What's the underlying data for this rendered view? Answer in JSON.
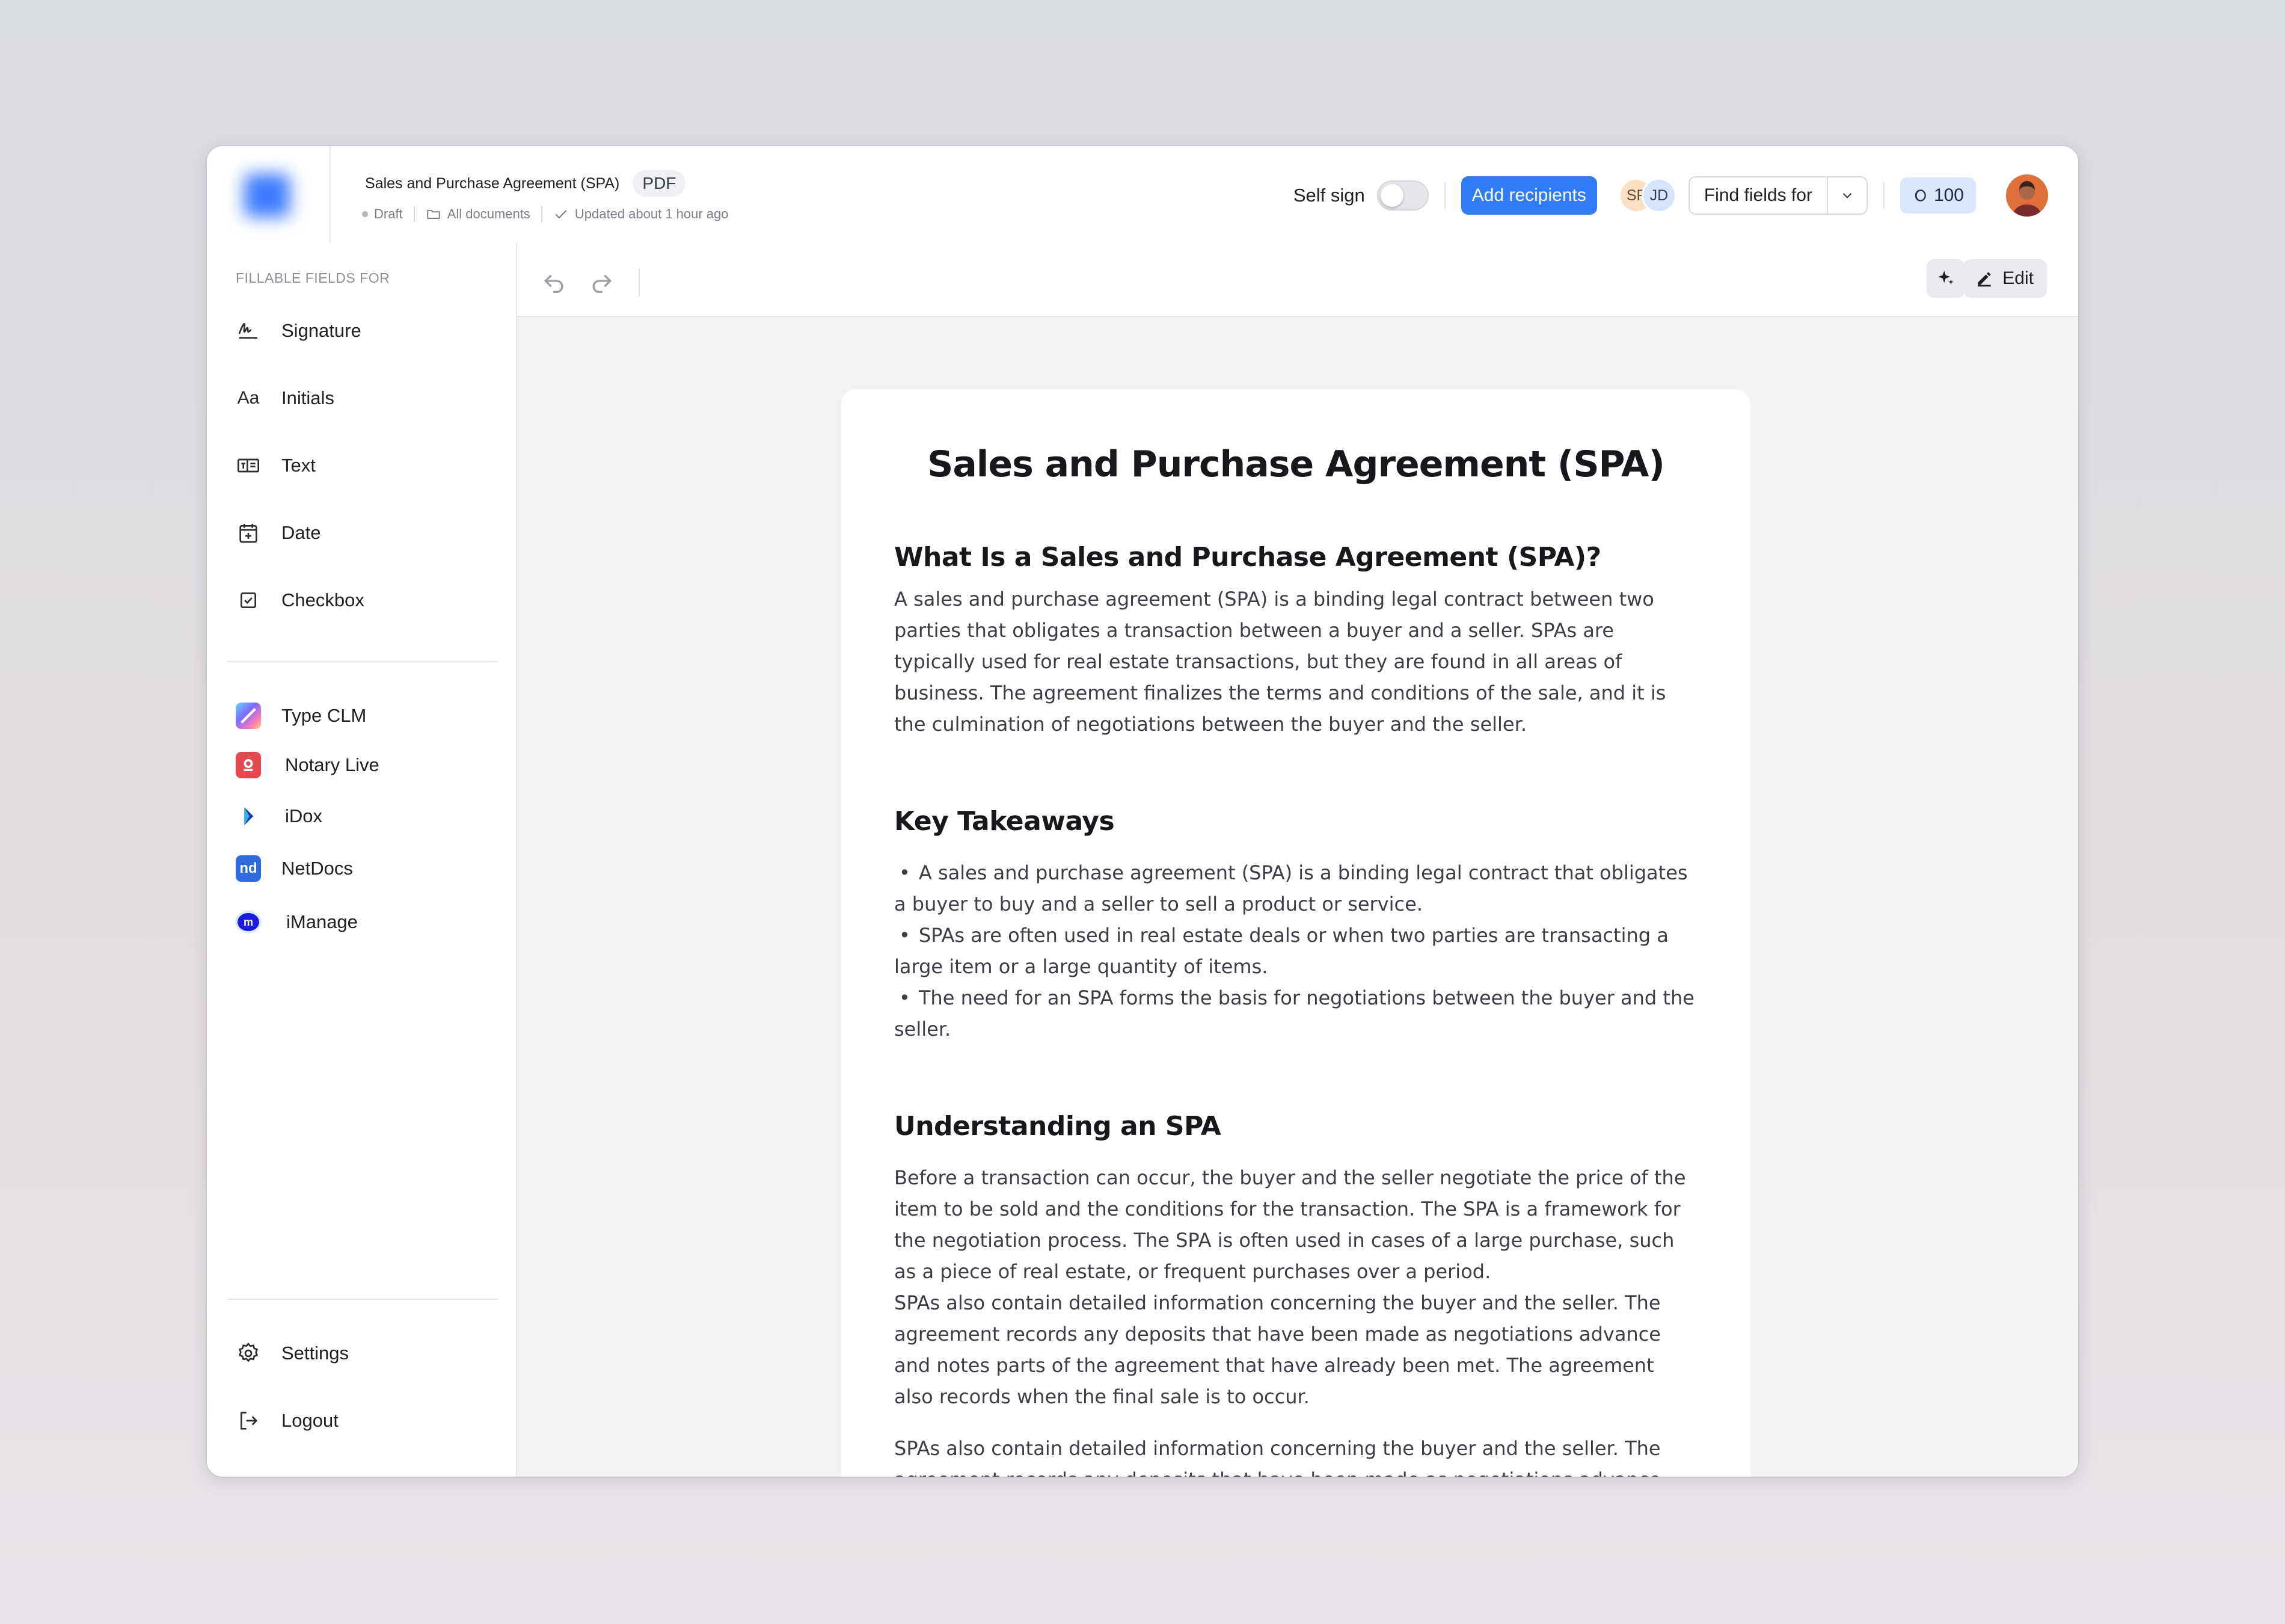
{
  "header": {
    "doc_title": "Sales and Purchase Agreement (SPA)",
    "doc_format": "PDF",
    "status": "Draft",
    "location": "All documents",
    "updated": "Updated about 1 hour ago",
    "self_sign_label": "Self sign",
    "self_sign_on": false,
    "add_recipients": "Add recipients",
    "recipient_initials": [
      "SF",
      "JD"
    ],
    "find_fields": "Find fields for",
    "credits": "100",
    "accent_color": "#2f7cf6"
  },
  "sidebar": {
    "heading": "FILLABLE FIELDS FOR",
    "fields": [
      {
        "label": "Signature",
        "icon": "signature-icon"
      },
      {
        "label": "Initials",
        "icon": "initials-icon"
      },
      {
        "label": "Text",
        "icon": "text-field-icon"
      },
      {
        "label": "Date",
        "icon": "calendar-icon"
      },
      {
        "label": "Checkbox",
        "icon": "checkbox-icon"
      }
    ],
    "integrations": [
      {
        "label": "Type CLM",
        "icon": "type-clm-icon"
      },
      {
        "label": "Notary Live",
        "icon": "notary-live-icon"
      },
      {
        "label": "iDox",
        "icon": "idox-icon"
      },
      {
        "label": "NetDocs",
        "icon": "netdocs-icon",
        "icon_text": "nd"
      },
      {
        "label": "iManage",
        "icon": "imanage-icon",
        "icon_text": "m"
      }
    ],
    "settings": "Settings",
    "logout": "Logout"
  },
  "toolbar": {
    "edit_label": "Edit"
  },
  "document": {
    "title": "Sales and Purchase Agreement (SPA)",
    "s1_heading": "What Is a Sales and Purchase Agreement (SPA)?",
    "s1_body": "A sales and purchase agreement (SPA) is a binding legal contract between two parties that obligates a transaction between a buyer and a seller. SPAs are typically used for real estate transactions, but they are found in all areas of business. The agreement finalizes the terms and conditions of the sale, and it is the culmination of negotiations between the buyer and the seller.",
    "s2_heading": "Key Takeaways",
    "s2_bullets": [
      "A sales and purchase agreement (SPA) is a binding legal contract that obligates a buyer to buy and a seller to sell a product or service.",
      "SPAs are often used in real estate deals or when two parties are transacting a large item or a large quantity of items.",
      "The need for an SPA forms the basis for negotiations between the buyer and the seller."
    ],
    "s3_heading": "Understanding an SPA",
    "s3_body1": "Before a transaction can occur, the buyer and the seller negotiate the price of the item to be sold and the conditions for the transaction. The SPA is a framework for the negotiation process. The SPA is often used in cases of a large purchase, such as a piece of real estate, or frequent purchases over a period.",
    "s3_body2": "SPAs also contain detailed information concerning the buyer and the seller. The agreement records any deposits that have been made as negotiations advance and notes parts of the agreement that have already been met. The agreement also records when the final sale is to occur.",
    "s3_body3": "SPAs also contain detailed information concerning the buyer and the seller. The agreement records any deposits that have been made as negotiations advance and notes parts of the agreement that have already been met."
  }
}
